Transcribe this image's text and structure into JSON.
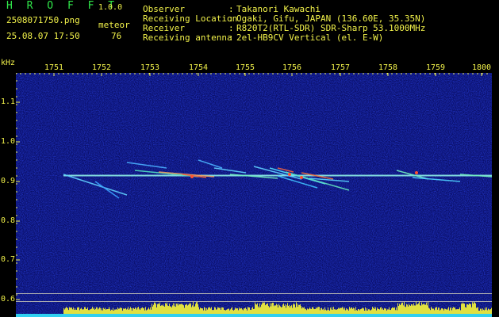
{
  "header": {
    "app_title": "H R O F F T",
    "version": "1.0.0",
    "file_name": "2508071750.png",
    "meteor_label": "meteor",
    "timestamp": "25.08.07 17:50",
    "meteor_count": "76",
    "info": [
      {
        "label": "Observer",
        "value": "Takanori Kawachi"
      },
      {
        "label": "Receiving Location",
        "value": "Ogaki, Gifu, JAPAN (136.60E, 35.35N)"
      },
      {
        "label": "Receiver",
        "value": "R820T2(RTL-SDR) SDR-Sharp 53.1000MHz"
      },
      {
        "label": "Receiving antenna",
        "value": "2el-HB9CV Vertical (el. E-W)"
      }
    ]
  },
  "axes": {
    "unit": "kHz",
    "time_ticks": [
      "1751",
      "1752",
      "1753",
      "1754",
      "1755",
      "1756",
      "1757",
      "1758",
      "1759",
      "1800"
    ],
    "freq_ticks": [
      "1.1",
      "1.0",
      "0.9",
      "0.8",
      "0.7",
      "0.6"
    ]
  },
  "colors": {
    "label_yellow": "#f2f24a",
    "label_green": "#30e84a",
    "noise_background": "#0a0f6a",
    "carrier_line": "#8ef0e8",
    "level_bar": "#e0e040",
    "baseline_cyan": "#30d0f0"
  }
}
